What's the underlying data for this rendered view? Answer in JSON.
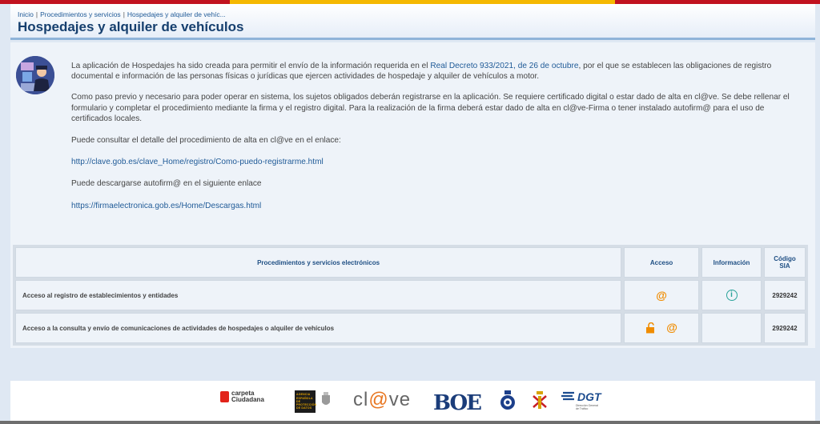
{
  "breadcrumb": {
    "items": [
      "Inicio",
      "Procedimientos y servicios",
      "Hospedajes y alquiler de vehíc..."
    ],
    "separator": "|"
  },
  "page": {
    "title": "Hospedajes y alquiler de vehículos"
  },
  "intro": {
    "p1_pre": "La aplicación de Hospedajes ha sido creada para permitir el envío de la información requerida en el ",
    "p1_link": "Real Decreto 933/2021, de 26 de octubre",
    "p1_post": ", por el que se establecen las obligaciones de registro documental e información de las personas físicas o jurídicas que ejercen actividades de hospedaje y alquiler de vehículos a motor.",
    "p2": "Como paso previo y necesario para poder operar en sistema, los sujetos obligados deberán registrarse en la aplicación. Se requiere certificado digital o estar dado de alta en cl@ve. Se debe rellenar el formulario y completar el procedimiento mediante la firma y el registro digital. Para la realización de la firma deberá estar dado de alta en cl@ve-Firma o tener instalado autofirm@ para el uso de certificados locales.",
    "p3": "Puede consultar el detalle del procedimiento de alta en cl@ve en el enlace:",
    "link_clave": "http://clave.gob.es/clave_Home/registro/Como-puedo-registrarme.html",
    "p4": "Puede descargarse autofirm@ en el siguiente enlace",
    "link_firma": "https://firmaelectronica.gob.es/Home/Descargas.html"
  },
  "table": {
    "headers": {
      "procedures": "Procedimientos y servicios electrónicos",
      "access": "Acceso",
      "info": "Información",
      "code": "Código SIA"
    },
    "rows": [
      {
        "name": "Acceso al registro de establecimientos y entidades",
        "access": "@",
        "info": "i",
        "code": "2929242"
      },
      {
        "name": "Acceso a la consulta y envío de comunicaciones de actividades de hospedajes o alquiler de vehículos",
        "access": "@",
        "info": "",
        "code": "2929242"
      }
    ]
  },
  "footer": {
    "carpeta_line1": "carpeta",
    "carpeta_line2": "Ciudadana",
    "aepd_text": "AGENCIA ESPAÑOLA DE PROTECCIÓN DE DATOS",
    "clave_pre": "cl",
    "clave_at": "@",
    "clave_post": "ve",
    "boe": "BOE",
    "dgt": "DGT",
    "dgt_sub": "Dirección General de Tráfico"
  },
  "colors": {
    "title": "#163f6e",
    "link": "#1f5a97",
    "accent_orange": "#f08c00",
    "info_teal": "#2aa39a",
    "flag_red": "#c1121f",
    "flag_yellow": "#f5b800"
  },
  "icons": [
    "user-avatar-icon",
    "at-icon",
    "info-icon",
    "unlocked-lock-icon"
  ]
}
